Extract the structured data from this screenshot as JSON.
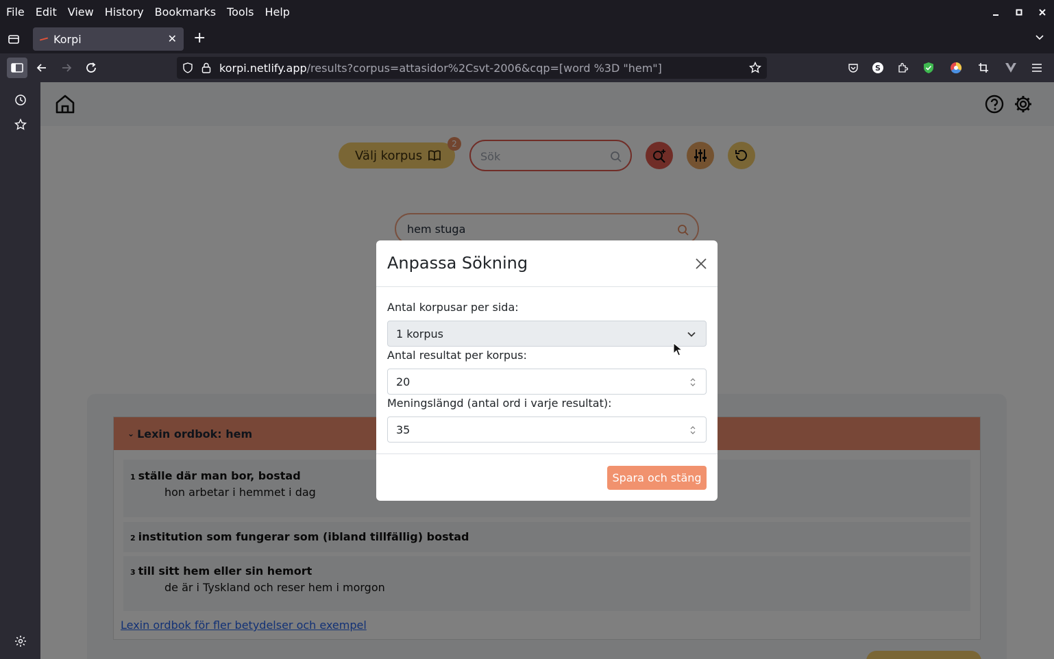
{
  "menubar": {
    "items": [
      "File",
      "Edit",
      "View",
      "History",
      "Bookmarks",
      "Tools",
      "Help"
    ]
  },
  "tab": {
    "title": "Korpi"
  },
  "urlbar": {
    "host": "korpi.netlify.app",
    "path": "/results?corpus=attasidor%2Csvt-2006&cqp=[word %3D \"hem\"]"
  },
  "page": {
    "valj_label": "Välj korpus",
    "valj_badge": "2",
    "top_search_placeholder": "Sök",
    "mid_search_value": "hem stuga",
    "lexin": {
      "header": "Lexin ordbok: hem",
      "senses": [
        {
          "num": "1",
          "def": "ställe där man bor, bostad",
          "example": "hon arbetar i hemmet i dag"
        },
        {
          "num": "2",
          "def": "institution som fungerar som (ibland tillfällig) bostad",
          "example": ""
        },
        {
          "num": "3",
          "def": "till sitt hem eller sin hemort",
          "example": "de är i Tyskland och reser hem i morgon"
        }
      ],
      "link": "Lexin ordbok för fler betydelser och exempel"
    }
  },
  "modal": {
    "title": "Anpassa Sökning",
    "corpora_label": "Antal korpusar per sida:",
    "corpora_value": "1 korpus",
    "results_label": "Antal resultat per korpus:",
    "results_value": "20",
    "length_label": "Meningslängd (antal ord i varje resultat):",
    "length_value": "35",
    "save_label": "Spara och stäng"
  },
  "colors": {
    "accent_orange": "#f1926e",
    "gold": "#f4cd6a",
    "red": "#e15b4f"
  }
}
